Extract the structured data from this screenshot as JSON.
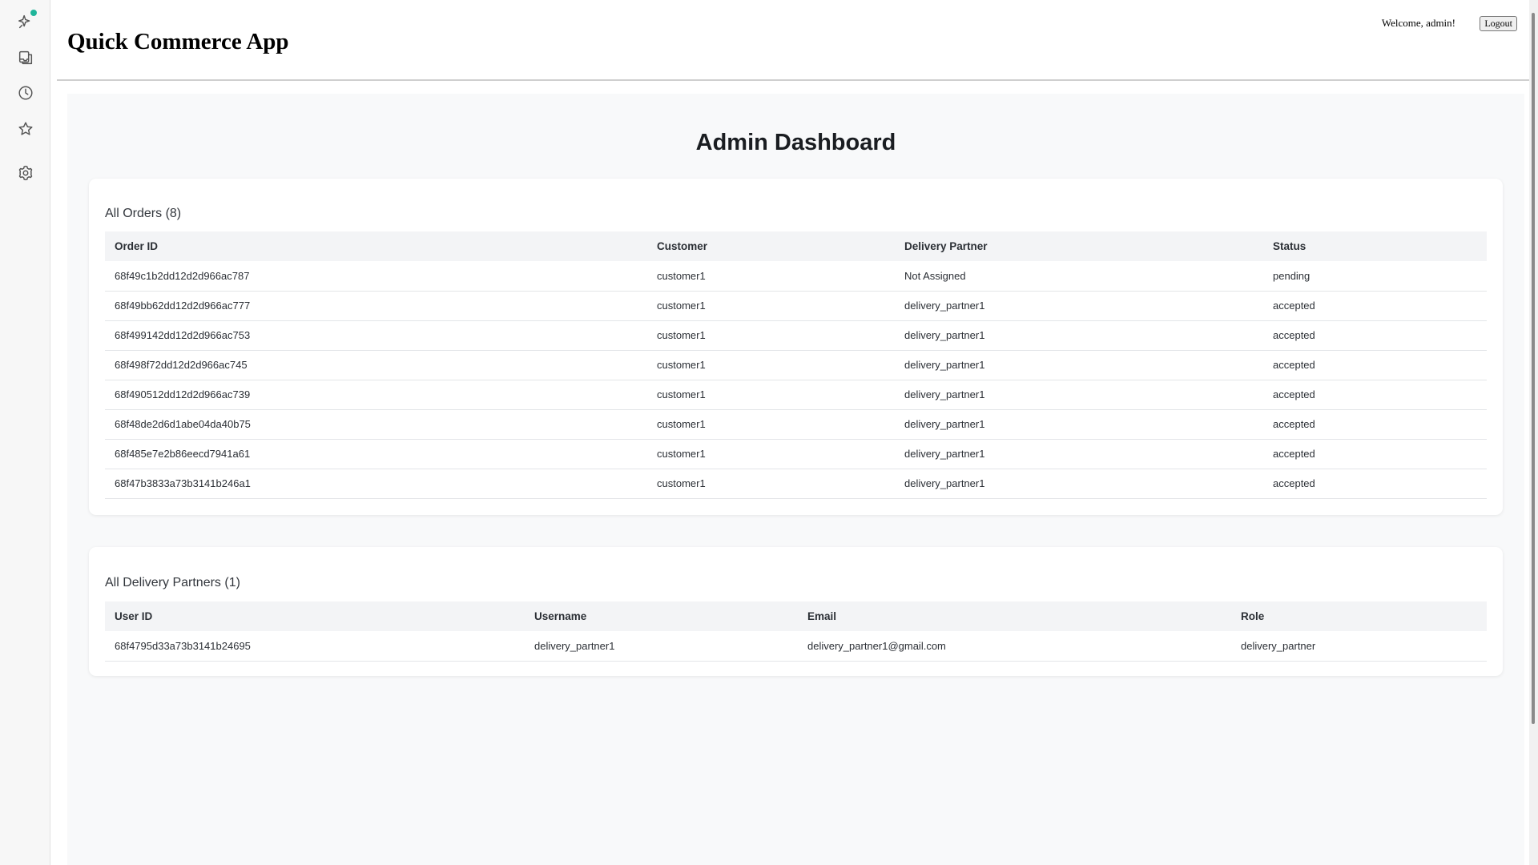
{
  "sidebar": {
    "icons": [
      "sparkle-icon",
      "inbox-icon",
      "history-icon",
      "star-icon",
      "settings-icon"
    ],
    "accent_color": "#1fb59a"
  },
  "header": {
    "app_title": "Quick Commerce App",
    "welcome_text": "Welcome, admin!",
    "logout_label": "Logout"
  },
  "main": {
    "title": "Admin Dashboard",
    "orders": {
      "title": "All Orders (8)",
      "columns": [
        "Order ID",
        "Customer",
        "Delivery Partner",
        "Status"
      ],
      "rows": [
        [
          "68f49c1b2dd12d2d966ac787",
          "customer1",
          "Not Assigned",
          "pending"
        ],
        [
          "68f49bb62dd12d2d966ac777",
          "customer1",
          "delivery_partner1",
          "accepted"
        ],
        [
          "68f499142dd12d2d966ac753",
          "customer1",
          "delivery_partner1",
          "accepted"
        ],
        [
          "68f498f72dd12d2d966ac745",
          "customer1",
          "delivery_partner1",
          "accepted"
        ],
        [
          "68f490512dd12d2d966ac739",
          "customer1",
          "delivery_partner1",
          "accepted"
        ],
        [
          "68f48de2d6d1abe04da40b75",
          "customer1",
          "delivery_partner1",
          "accepted"
        ],
        [
          "68f485e7e2b86eecd7941a61",
          "customer1",
          "delivery_partner1",
          "accepted"
        ],
        [
          "68f47b3833a73b3141b246a1",
          "customer1",
          "delivery_partner1",
          "accepted"
        ]
      ]
    },
    "partners": {
      "title": "All Delivery Partners (1)",
      "columns": [
        "User ID",
        "Username",
        "Email",
        "Role"
      ],
      "rows": [
        [
          "68f4795d33a73b3141b24695",
          "delivery_partner1",
          "delivery_partner1@gmail.com",
          "delivery_partner"
        ]
      ]
    }
  }
}
